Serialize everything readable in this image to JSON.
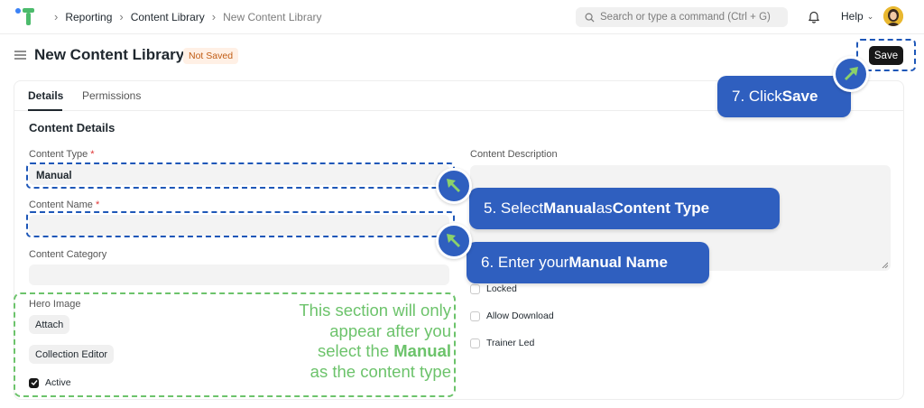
{
  "navbar": {
    "breadcrumbs": [
      "Reporting",
      "Content Library",
      "New Content Library"
    ],
    "search_placeholder": "Search or type a command (Ctrl + G)",
    "help_label": "Help",
    "logo_icon": "frappe-logo-icon",
    "bell_icon": "bell-icon",
    "avatar_icon": "user-avatar"
  },
  "page": {
    "title": "New Content Library",
    "status_badge": "Not Saved",
    "save_label": "Save"
  },
  "tabs": [
    "Details",
    "Permissions"
  ],
  "form": {
    "section_title": "Content Details",
    "content_type": {
      "label": "Content Type",
      "required_mark": "*",
      "value": "Manual"
    },
    "content_name": {
      "label": "Content Name",
      "required_mark": "*",
      "value": ""
    },
    "content_category": {
      "label": "Content Category",
      "value": ""
    },
    "content_description": {
      "label": "Content Description",
      "value": ""
    },
    "hero_image_label": "Hero Image",
    "attach_label": "Attach",
    "collection_editor_label": "Collection Editor",
    "active": {
      "label": "Active",
      "checked": true
    },
    "locked": {
      "label": "Locked",
      "checked": false
    },
    "allow_download": {
      "label": "Allow Download",
      "checked": false
    },
    "trainer_led": {
      "label": "Trainer Led",
      "checked": false
    }
  },
  "annotations": {
    "step5": {
      "pre": "5. Select ",
      "b1": "Manual",
      "mid": " as ",
      "b2": "Content Type"
    },
    "step6": {
      "pre": "6. Enter your ",
      "b1": "Manual Name"
    },
    "step7": {
      "pre": "7. Click ",
      "b1": "Save"
    },
    "note": {
      "line1": "This section will only",
      "line2": "appear after you",
      "line3_pre": "select the ",
      "line3_b": "Manual",
      "line4": "as the content type"
    }
  },
  "colors": {
    "callout_blue": "#2f5fbf",
    "dash_blue": "#1e57b8",
    "note_green": "#6cc36b",
    "cursor_green": "#8bd16a",
    "badge_bg": "#fff0e5",
    "badge_text": "#c05c14"
  }
}
